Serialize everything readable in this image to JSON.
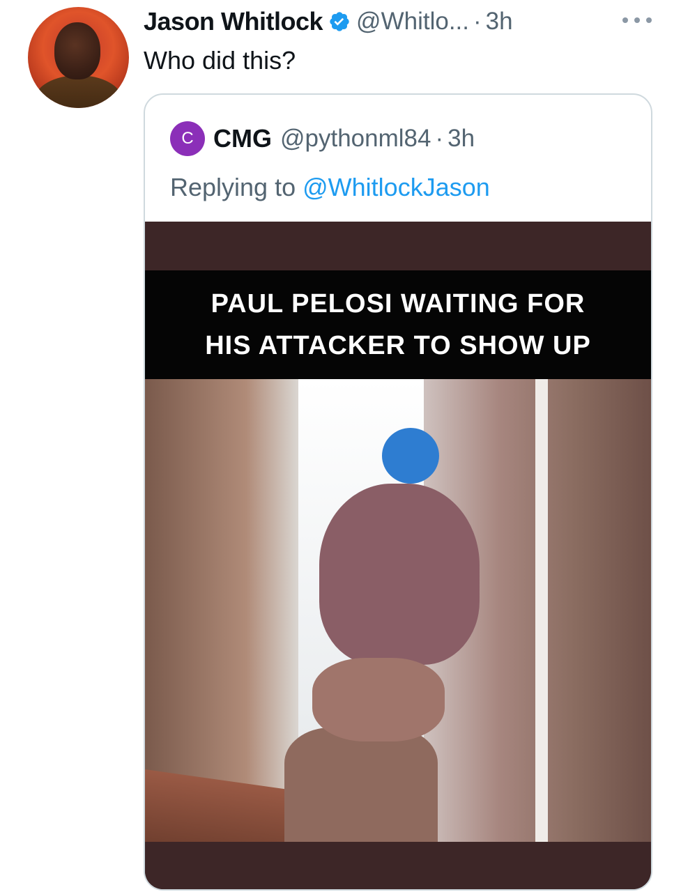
{
  "tweet": {
    "author_name": "Jason Whitlock",
    "author_handle": "@Whitlo...",
    "separator": "·",
    "time": "3h",
    "text": "Who did this?"
  },
  "quoted_tweet": {
    "avatar_letter": "C",
    "author_name": "CMG",
    "author_handle": "@pythonml84",
    "separator": "·",
    "time": "3h",
    "replying_prefix": "Replying to",
    "replying_handle": "@WhitlockJason",
    "media": {
      "caption_line1": "PAUL PELOSI WAITING FOR",
      "caption_line2": "HIS ATTACKER TO SHOW UP"
    }
  },
  "icons": {
    "verified": "verified-badge-icon",
    "more": "more-options-icon"
  },
  "colors": {
    "text_primary": "#0f1419",
    "text_secondary": "#536471",
    "link": "#1d9bf0",
    "border": "#cfd9de",
    "quoted_avatar": "#8b2fb8"
  }
}
